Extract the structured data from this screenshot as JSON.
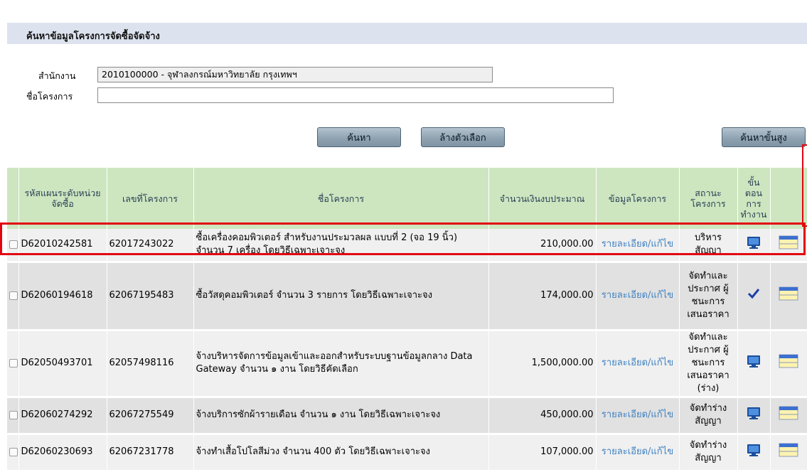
{
  "section_title": "ค้นหาข้อมูลโครงการจัดซื้อจัดจ้าง",
  "form": {
    "agency_label": "สำนักงาน",
    "agency_value": "2010100000 - จุฬาลงกรณ์มหาวิทยาลัย กรุงเทพฯ",
    "project_name_label": "ชื่อโครงการ",
    "project_name_value": ""
  },
  "buttons": {
    "search": "ค้นหา",
    "clear": "ล้างตัวเลือก",
    "advanced_search": "ค้นหาขั้นสูง"
  },
  "table": {
    "headers": {
      "plan_code": "รหัสแผนระดับหน่วยจัดซื้อ",
      "project_no": "เลขที่โครงการ",
      "project_name": "ชื่อโครงการ",
      "budget": "จำนวนเงินงบประมาณ",
      "project_info": "ข้อมูลโครงการ",
      "status": "สถานะโครงการ",
      "step": "ขั้นตอนการทำงาน"
    },
    "rows": [
      {
        "plan_code": "D62010242581",
        "project_no": "62017243022",
        "name": "ซื้อเครื่องคอมพิวเตอร์ สำหรับงานประมวลผล แบบที่ 2 (จอ 19 นิ้ว) จำนวน 7 เครื่อง โดยวิธีเฉพาะเจาะจง",
        "budget": "210,000.00",
        "detail": "รายละเอียด/แก้ไข",
        "status": "บริหารสัญญา",
        "step_icon": "computer-icon"
      },
      {
        "plan_code": "D62060194618",
        "project_no": "62067195483",
        "name": "ซื้อวัสดุคอมพิวเตอร์ จำนวน 3 รายการ โดยวิธีเฉพาะเจาะจง",
        "budget": "174,000.00",
        "detail": "รายละเอียด/แก้ไข",
        "status": "จัดทำและประกาศ ผู้ชนะการเสนอราคา",
        "step_icon": "checkmark-icon"
      },
      {
        "plan_code": "D62050493701",
        "project_no": "62057498116",
        "name": "จ้างบริหารจัดการข้อมูลเข้าและออกสำหรับระบบฐานข้อมูลกลาง Data Gateway จำนวน ๑ งาน โดยวิธีคัดเลือก",
        "budget": "1,500,000.00",
        "detail": "รายละเอียด/แก้ไข",
        "status": "จัดทำและประกาศ ผู้ชนะการเสนอราคา (ร่าง)",
        "step_icon": "computer-icon"
      },
      {
        "plan_code": "D62060274292",
        "project_no": "62067275549",
        "name": "จ้างบริการซักผ้ารายเดือน จำนวน ๑ งาน โดยวิธีเฉพาะเจาะจง",
        "budget": "450,000.00",
        "detail": "รายละเอียด/แก้ไข",
        "status": "จัดทำร่างสัญญา",
        "step_icon": "computer-icon"
      },
      {
        "plan_code": "D62060230693",
        "project_no": "62067231778",
        "name": "จ้างทำเสื้อโปโลสีม่วง จำนวน 400 ตัว โดยวิธีเฉพาะเจาะจง",
        "budget": "107,000.00",
        "detail": "รายละเอียด/แก้ไข",
        "status": "จัดทำร่างสัญญา",
        "step_icon": "computer-icon"
      }
    ]
  },
  "colors": {
    "header_bg": "#cde6c0",
    "section_bg": "#dde3ee",
    "link": "#3f82c2",
    "highlight": "#e20612"
  }
}
